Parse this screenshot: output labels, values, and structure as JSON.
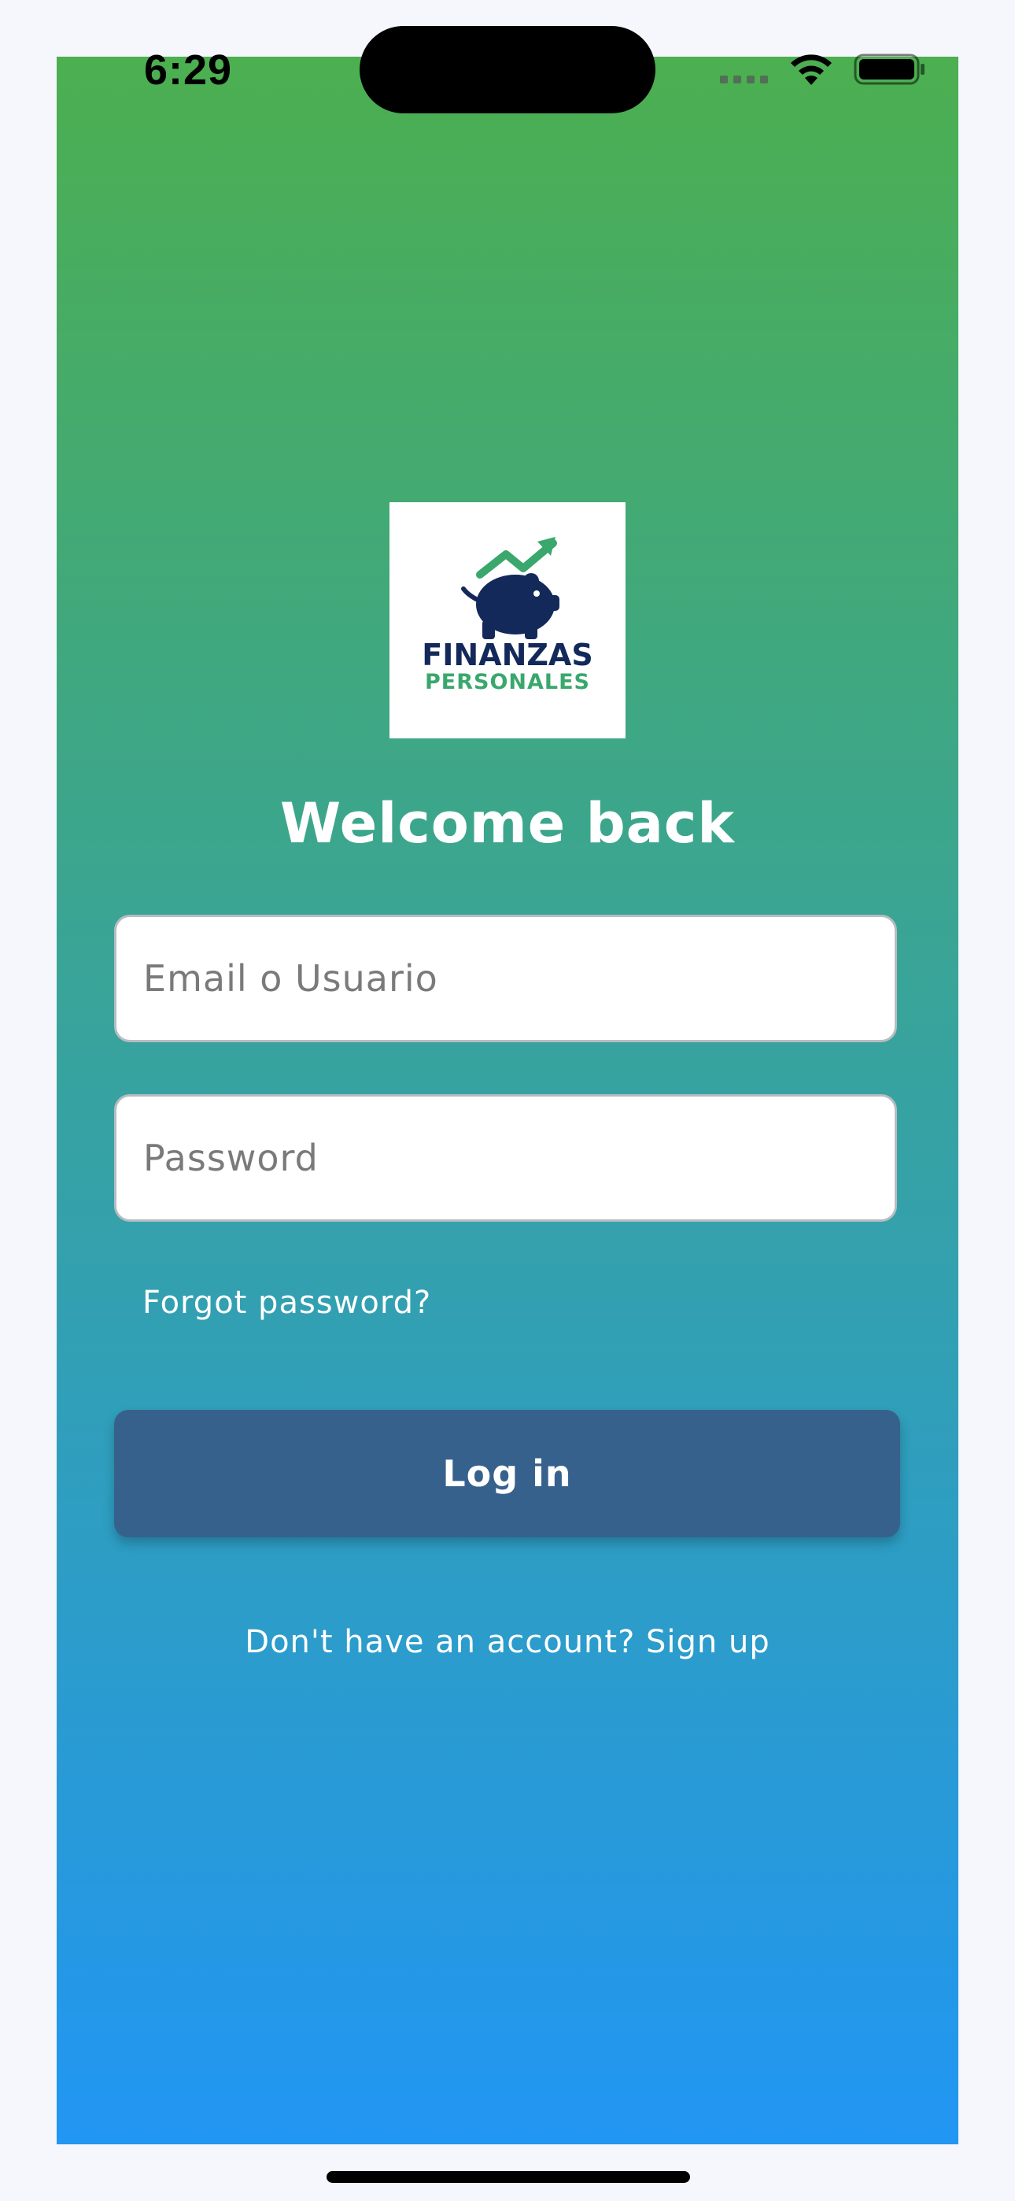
{
  "status_bar": {
    "time": "6:29",
    "icons": [
      "cellular-icon",
      "wifi-icon",
      "battery-icon"
    ]
  },
  "logo": {
    "line1": "FINANZAS",
    "line2": "PERSONALES",
    "icon": "piggy-bank-trend-icon"
  },
  "login": {
    "title": "Welcome back",
    "email_placeholder": "Email o Usuario",
    "email_value": "",
    "password_placeholder": "Password",
    "password_value": "",
    "forgot_label": "Forgot password?",
    "login_label": "Log in",
    "signup_label": "Don't have an account? Sign up"
  },
  "colors": {
    "gradient_top": "#4caf50",
    "gradient_bottom": "#2196f3",
    "button": "#37618d",
    "logo_navy": "#13295a",
    "logo_green": "#3aa76d"
  }
}
